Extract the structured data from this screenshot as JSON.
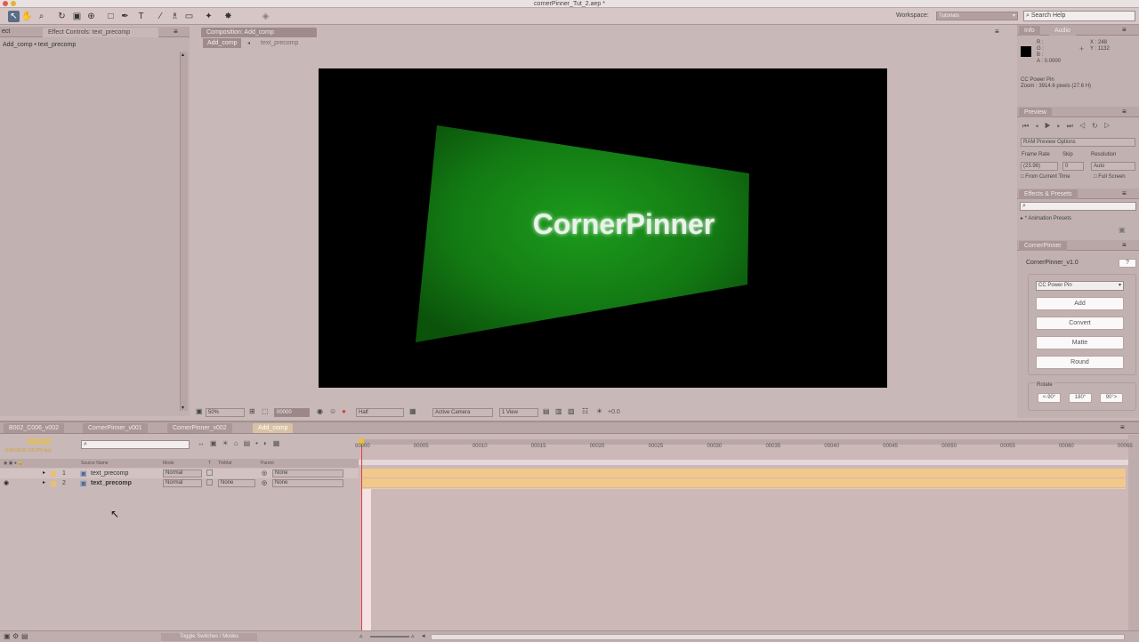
{
  "window": {
    "title": "cornerPinner_Tut_2.aep *"
  },
  "header": {
    "workspace_label": "Workspace:",
    "workspace_value": "Tutorials",
    "search_placeholder": "Search Help"
  },
  "left_panel": {
    "left_stub": "ect",
    "tab_label": "Effect Controls: text_precomp",
    "breadcrumb": "Add_comp • text_precomp"
  },
  "comp_panel": {
    "tab_label": "Composition: Add_comp",
    "nav_active": "Add_comp",
    "nav_other": "text_precomp",
    "zoom": "50%",
    "timecode": "00000",
    "resolution": "Half",
    "camera": "Active Camera",
    "views": "1 View",
    "exposure": "+0.0",
    "viewer_text": "CornerPinner"
  },
  "info_panel": {
    "tabs": [
      "Info",
      "Audio"
    ],
    "r": "R :",
    "g": "G :",
    "b": "B :",
    "a": "A : 0.0000",
    "x": "X : 248",
    "y": "Y : 1132",
    "effect": "CC Power Pin",
    "zoom_line": "Zoom : 3914.6 pixels (27.6 H)"
  },
  "preview_panel": {
    "title": "Preview",
    "ram_options": "RAM Preview Options",
    "frame_rate_label": "Frame Rate",
    "skip_label": "Skip",
    "resolution_label": "Resolution",
    "frame_rate": "(23.98)",
    "skip": "0",
    "resolution": "Auto",
    "from_current": "From Current Time",
    "full_screen": "Full Screen"
  },
  "effects_panel": {
    "title": "Effects & Presets",
    "search_value": "",
    "presets": "* Animation Presets"
  },
  "cornerpinner_panel": {
    "title": "CornerPinner",
    "version": "CornerPinner_v1.0",
    "help": "?",
    "dropdown": "CC Power Pin",
    "buttons": [
      "Add",
      "Convert",
      "Matte",
      "Round"
    ],
    "rotate_label": "Rotate",
    "rotate_buttons": [
      "<-90°",
      "180°",
      "90°>"
    ]
  },
  "timeline": {
    "tabs": [
      "B002_C006_v002",
      "CornerPinner_v001",
      "CornerPinner_v002",
      "Add_comp"
    ],
    "active_tab": 3,
    "timecode": "00000",
    "timecode_sub": "0:00:00:00 (23.976 fps)",
    "search_value": "",
    "col_source": "Source Name",
    "col_mode": "Mode",
    "col_t": "T",
    "col_trkmat": "TrkMat",
    "col_parent": "Parent",
    "ticks": [
      "00000",
      "00005",
      "00010",
      "00015",
      "00020",
      "00025",
      "00030",
      "00035",
      "00040",
      "00045",
      "00050",
      "00055",
      "00060",
      "00065"
    ],
    "layers": [
      {
        "num": "1",
        "name": "text_precomp",
        "mode": "Normal",
        "trkmat": "",
        "parent": "None"
      },
      {
        "num": "2",
        "name": "text_precomp",
        "mode": "Normal",
        "trkmat": "None",
        "parent": "None"
      }
    ],
    "toggle_label": "Toggle Switches / Modes"
  },
  "colors": {
    "panel_bg": "#c2b1b1",
    "accent_orange": "#f2c27a",
    "viewer_bg": "#000000",
    "green": "#1fa51f"
  }
}
